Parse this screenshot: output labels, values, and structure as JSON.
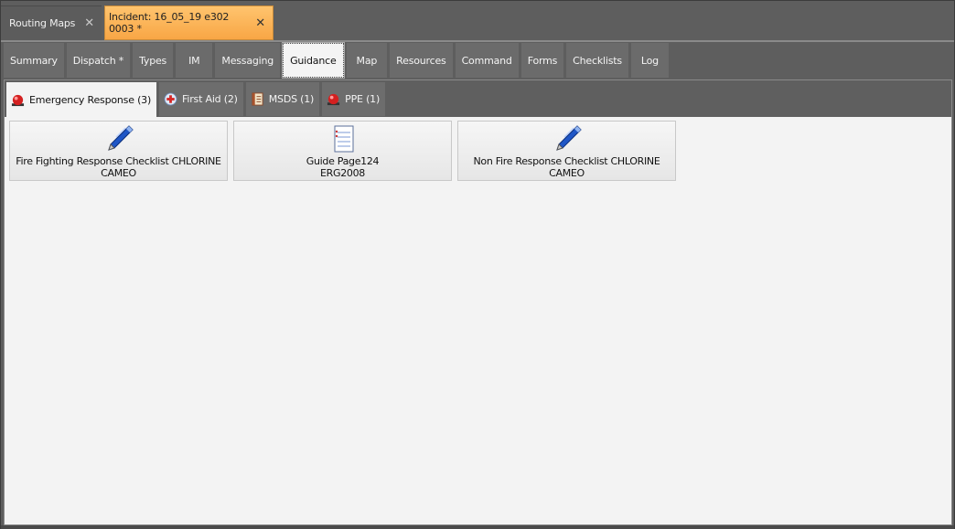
{
  "doc_tabs": [
    {
      "label": "Routing Maps",
      "active": false
    },
    {
      "label": "Incident: 16_05_19 e302 0003 *",
      "active": true
    }
  ],
  "main_tabs": [
    "Summary",
    "Dispatch *",
    "Types",
    "IM",
    "Messaging",
    "Guidance",
    "Map",
    "Resources",
    "Command",
    "Forms",
    "Checklists",
    "Log"
  ],
  "main_tab_selected": "Guidance",
  "sub_tabs": [
    {
      "label": "Emergency Response (3)",
      "icon": "alarm-light-icon"
    },
    {
      "label": "First Aid (2)",
      "icon": "first-aid-icon"
    },
    {
      "label": "MSDS (1)",
      "icon": "document-book-icon"
    },
    {
      "label": "PPE (1)",
      "icon": "alarm-light-icon"
    }
  ],
  "cards": [
    {
      "line1": "Fire Fighting Response Checklist CHLORINE",
      "line2": "CAMEO",
      "icon": "pen-icon"
    },
    {
      "line1": "Guide Page124",
      "line2": "ERG2008",
      "icon": "notepad-icon"
    },
    {
      "line1": "Non Fire Response Checklist CHLORINE",
      "line2": "CAMEO",
      "icon": "pen-icon"
    }
  ],
  "colors": {
    "active_doc_tab": "#f8a645",
    "dark_bg": "#5e5e5e",
    "panel_bg": "#f3f3f3"
  }
}
